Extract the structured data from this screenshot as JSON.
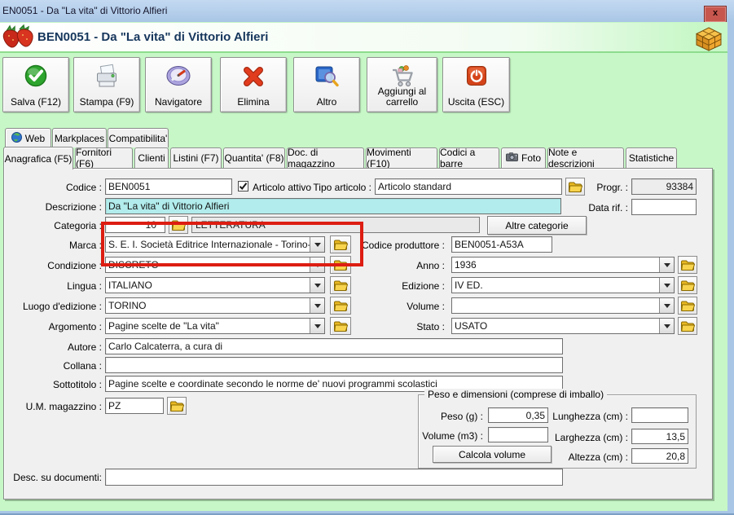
{
  "window": {
    "titlebar_text": "EN0051 - Da \"La vita\" di Vittorio Alfieri",
    "close_label": "x",
    "header_title": "BEN0051 - Da \"La vita\" di Vittorio Alfieri"
  },
  "toolbar": {
    "buttons": [
      {
        "label": "Salva (F12)",
        "icon": "save-check-icon"
      },
      {
        "label": "Stampa (F9)",
        "icon": "printer-icon"
      },
      {
        "label": "Navigatore",
        "icon": "compass-icon"
      },
      {
        "label": "Elimina",
        "icon": "red-x-icon"
      },
      {
        "label": "Altro",
        "icon": "book-search-icon"
      },
      {
        "label": "Aggiungi al carrello",
        "icon": "cart-icon"
      },
      {
        "label": "Uscita (ESC)",
        "icon": "power-icon"
      }
    ]
  },
  "tabs": {
    "row1": [
      {
        "label": "Web",
        "icon": "globe-icon"
      },
      {
        "label": "Markplaces"
      },
      {
        "label": "Compatibilita'"
      }
    ],
    "row2": [
      {
        "label": "Anagrafica (F5)",
        "selected": true
      },
      {
        "label": "Fornitori (F6)"
      },
      {
        "label": "Clienti"
      },
      {
        "label": "Listini (F7)"
      },
      {
        "label": "Quantita' (F8)"
      },
      {
        "label": "Doc. di magazzino"
      },
      {
        "label": "Movimenti (F10)"
      },
      {
        "label": "Codici a barre"
      },
      {
        "label": "Foto",
        "icon": "camera-icon"
      },
      {
        "label": "Note e descrizioni"
      },
      {
        "label": "Statistiche"
      }
    ]
  },
  "form": {
    "codice": {
      "label": "Codice :",
      "value": "BEN0051"
    },
    "articolo_attivo": {
      "label": "Articolo attivo",
      "checked": true
    },
    "tipo_articolo": {
      "label": "Tipo articolo :",
      "value": "Articolo standard"
    },
    "progr": {
      "label": "Progr. :",
      "value": "93384"
    },
    "descrizione": {
      "label": "Descrizione :",
      "value": "Da \"La vita\" di Vittorio Alfieri"
    },
    "data_rif": {
      "label": "Data rif. :",
      "value": ""
    },
    "categoria": {
      "label": "Categoria :",
      "value": "10",
      "name": "LETTERATURA"
    },
    "altre_categorie_label": "Altre categorie",
    "marca": {
      "label": "Marca :",
      "value": "S. E. I. Società Editrice Internazionale - Torino-Milan"
    },
    "codice_produttore": {
      "label": "Codice produttore :",
      "value": "BEN0051-A53A"
    },
    "condizione": {
      "label": "Condizione :",
      "value": "DISCRETO"
    },
    "anno": {
      "label": "Anno :",
      "value": "1936"
    },
    "lingua": {
      "label": "Lingua :",
      "value": "ITALIANO"
    },
    "edizione": {
      "label": "Edizione :",
      "value": "IV ED."
    },
    "luogo_edizione": {
      "label": "Luogo d'edizione :",
      "value": "TORINO"
    },
    "volume": {
      "label": "Volume :",
      "value": ""
    },
    "argomento": {
      "label": "Argomento :",
      "value": "Pagine scelte de \"La vita\""
    },
    "stato": {
      "label": "Stato :",
      "value": "USATO"
    },
    "autore": {
      "label": "Autore :",
      "value": "Carlo Calcaterra, a cura di"
    },
    "collana": {
      "label": "Collana :",
      "value": ""
    },
    "sottotitolo": {
      "label": "Sottotitolo :",
      "value": "Pagine scelte e coordinate secondo le norme de' nuovi programmi scolastici"
    },
    "um_magazzino": {
      "label": "U.M. magazzino :",
      "value": "PZ"
    },
    "desc_documenti": {
      "label": "Desc. su documenti:",
      "value": ""
    }
  },
  "peso_group": {
    "title": "Peso e dimensioni (comprese di imballo)",
    "peso": {
      "label": "Peso (g) :",
      "value": "0,35"
    },
    "volume_m3": {
      "label": "Volume (m3) :",
      "value": ""
    },
    "calcola_volume_label": "Calcola volume",
    "lunghezza": {
      "label": "Lunghezza (cm) :",
      "value": ""
    },
    "larghezza": {
      "label": "Larghezza (cm) :",
      "value": "13,5"
    },
    "altezza": {
      "label": "Altezza (cm) :",
      "value": "20,8"
    }
  },
  "colors": {
    "window_green": "#c7f7c7",
    "titlebar_blue": "#a9c6e6",
    "highlight_red": "#dd1d12",
    "descrizione_bg": "#b2ecec",
    "folder_yellow": "#f2c22e",
    "check_green": "#2ea52e"
  }
}
